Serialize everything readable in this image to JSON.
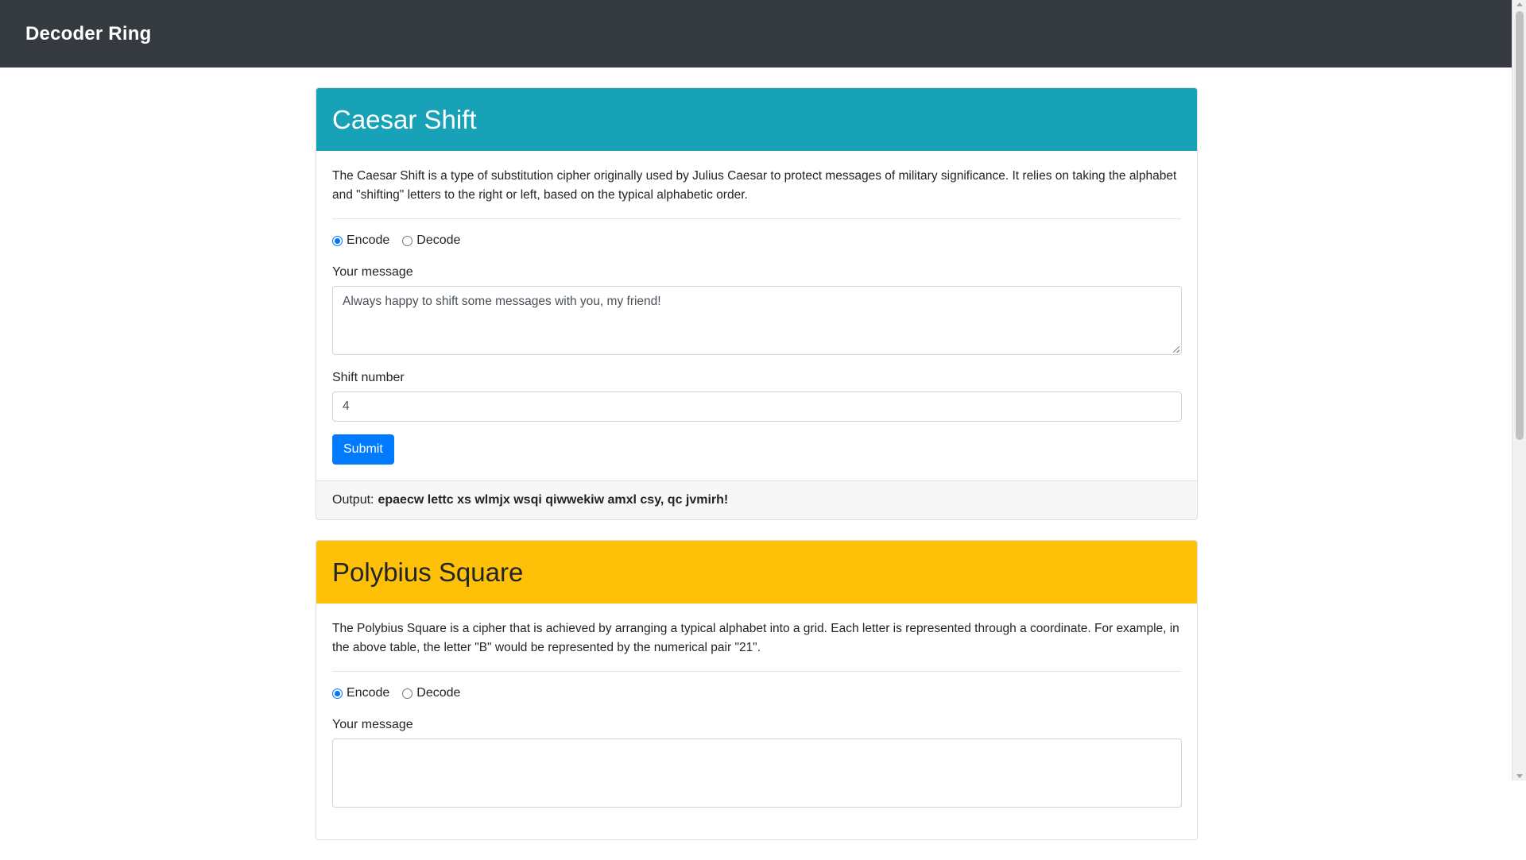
{
  "app": {
    "brand": "Decoder Ring"
  },
  "caesar": {
    "title": "Caesar Shift",
    "description": "The Caesar Shift is a type of substitution cipher originally used by Julius Caesar to protect messages of military significance. It relies on taking the alphabet and \"shifting\" letters to the right or left, based on the typical alphabetic order.",
    "encode_label": "Encode",
    "decode_label": "Decode",
    "selected_mode": "Encode",
    "message_label": "Your message",
    "message_value": "Always happy to shift some messages with you, my friend!",
    "shift_label": "Shift number",
    "shift_value": "4",
    "submit_label": "Submit",
    "output_label": "Output:",
    "output_value": "epaecw lettc xs wlmjx wsqi qiwwekiw amxl csy, qc jvmirh!",
    "header_color": "#17a2b8"
  },
  "polybius": {
    "title": "Polybius Square",
    "description": "The Polybius Square is a cipher that is achieved by arranging a typical alphabet into a grid. Each letter is represented through a coordinate. For example, in the above table, the letter \"B\" would be represented by the numerical pair \"21\".",
    "encode_label": "Encode",
    "decode_label": "Decode",
    "selected_mode": "Encode",
    "message_label": "Your message",
    "message_value": "",
    "header_color": "#ffc107"
  },
  "colors": {
    "navbar": "#343a40",
    "primary": "#007bff"
  }
}
